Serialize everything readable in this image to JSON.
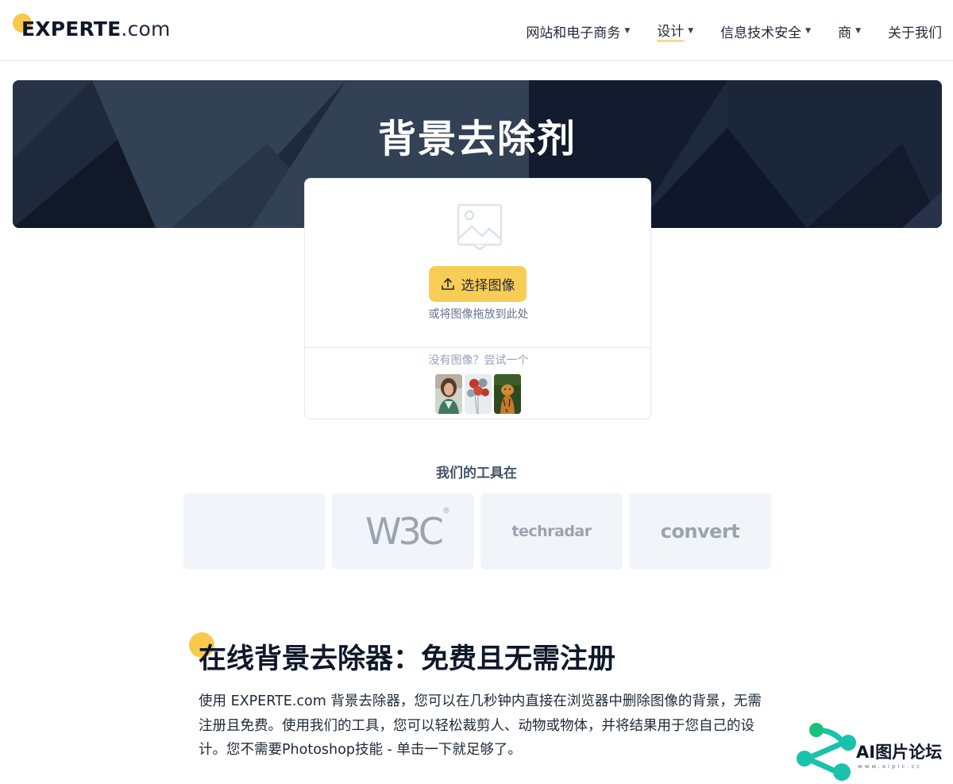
{
  "header": {
    "logo": {
      "brand": "EXPERTE",
      "suffix": ".com"
    },
    "nav": [
      {
        "label": "网站和电子商务",
        "has_caret": true,
        "active": false
      },
      {
        "label": "设计",
        "has_caret": true,
        "active": true
      },
      {
        "label": "信息技术安全",
        "has_caret": true,
        "active": false
      },
      {
        "label": "商",
        "has_caret": true,
        "active": false
      },
      {
        "label": "关于我们",
        "has_caret": false,
        "active": false
      }
    ]
  },
  "hero": {
    "title": "背景去除剂"
  },
  "upload": {
    "button_label": "选择图像",
    "drop_hint": "或将图像拖放到此处",
    "try_hint": "没有图像？尝试一个",
    "samples": [
      {
        "name": "woman-portrait"
      },
      {
        "name": "balloons"
      },
      {
        "name": "tiger"
      }
    ]
  },
  "featured": {
    "title": "我们的工具在",
    "logos": [
      "",
      "W3C",
      "techradar",
      "convert"
    ]
  },
  "article": {
    "title": "在线背景去除器：免费且无需注册",
    "body": "使用 EXPERTE.com 背景去除器，您可以在几秒钟内直接在浏览器中删除图像的背景，无需注册且免费。使用我们的工具，您可以轻松裁剪人、动物或物体，并将结果用于您自己的设计。您不需要Photoshop技能 - 单击一下就足够了。"
  },
  "watermark": {
    "text": "AI图片论坛",
    "sub": "www.aipic.cc"
  },
  "colors": {
    "accent": "#f8cd55",
    "hero_bg": "#1e293b",
    "text_dark": "#0f172a",
    "muted": "#64748b"
  }
}
